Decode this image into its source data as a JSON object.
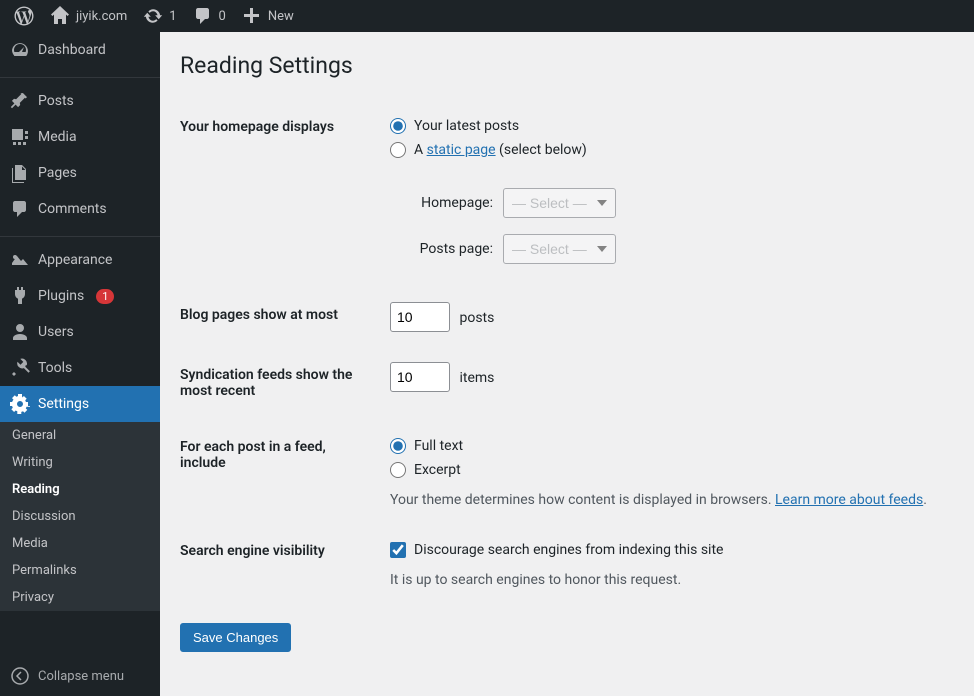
{
  "adminbar": {
    "site_name": "jiyik.com",
    "updates_count": "1",
    "comments_count": "0",
    "new_label": "New"
  },
  "sidebar": {
    "dashboard": "Dashboard",
    "posts": "Posts",
    "media": "Media",
    "pages": "Pages",
    "comments": "Comments",
    "appearance": "Appearance",
    "plugins": "Plugins",
    "plugins_badge": "1",
    "users": "Users",
    "tools": "Tools",
    "settings": "Settings",
    "sub": {
      "general": "General",
      "writing": "Writing",
      "reading": "Reading",
      "discussion": "Discussion",
      "media": "Media",
      "permalinks": "Permalinks",
      "privacy": "Privacy"
    },
    "collapse": "Collapse menu"
  },
  "page": {
    "title": "Reading Settings",
    "homepage_label": "Your homepage displays",
    "opt_latest": "Your latest posts",
    "opt_static_prefix": "A ",
    "opt_static_link": "static page",
    "opt_static_suffix": " (select below)",
    "homepage_select_label": "Homepage:",
    "postspage_select_label": "Posts page:",
    "select_placeholder": "— Select —",
    "blog_pages_label": "Blog pages show at most",
    "blog_pages_value": "10",
    "blog_pages_suffix": "posts",
    "syndication_label": "Syndication feeds show the most recent",
    "syndication_value": "10",
    "syndication_suffix": "items",
    "feed_label": "For each post in a feed, include",
    "feed_full": "Full text",
    "feed_excerpt": "Excerpt",
    "feed_desc": "Your theme determines how content is displayed in browsers. ",
    "feed_desc_link": "Learn more about feeds",
    "sev_label": "Search engine visibility",
    "sev_check": "Discourage search engines from indexing this site",
    "sev_desc": "It is up to search engines to honor this request.",
    "save": "Save Changes"
  }
}
